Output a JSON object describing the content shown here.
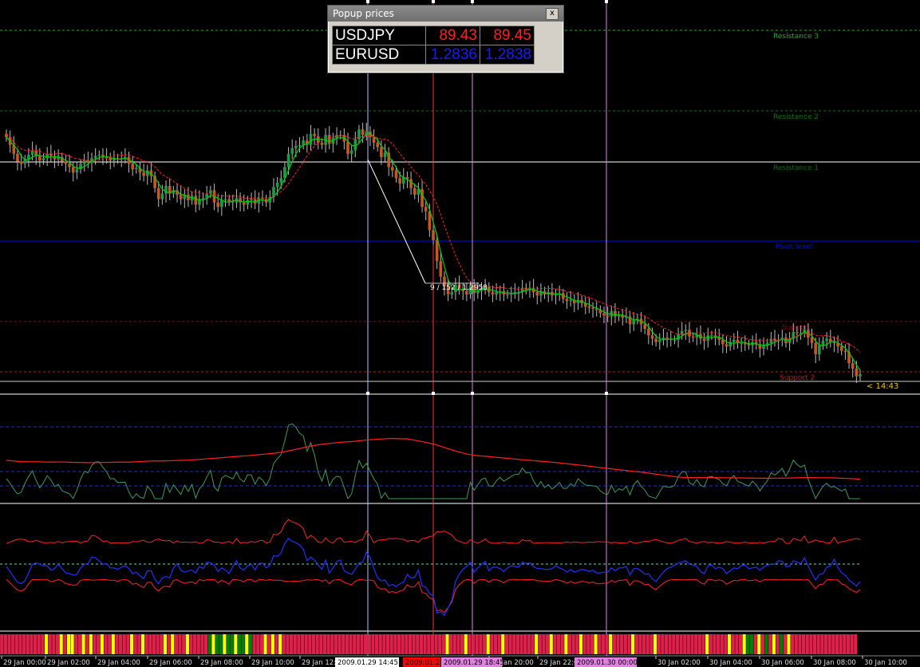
{
  "popup": {
    "title": "Popup prices",
    "close": "x",
    "rows": [
      {
        "symbol": "USDJPY",
        "bid": "89.43",
        "ask": "89.45",
        "color": "#ff2020"
      },
      {
        "symbol": "EURUSD",
        "bid": "1.2836",
        "ask": "1.2838",
        "color": "#1a1aff"
      }
    ]
  },
  "levels": {
    "resistance3": "Resistance 3",
    "resistance2": "Resistance 2",
    "resistance1": "Resistance 1",
    "pivot": "Pivot level",
    "support1": "Support",
    "support2": "Support 2"
  },
  "annotations": {
    "trendline": "9 / 152 / 1.2958",
    "countdown": "< 14:43"
  },
  "time_axis": {
    "labels": [
      "29 Jan 00:00",
      "29 Jan 02:00",
      "29 Jan 04:00",
      "29 Jan 06:00",
      "29 Jan 08:00",
      "29 Jan 10:00",
      "29 Jan 12:00",
      "29 Jan 20:00",
      "29 Jan 22:00",
      "30 Jan 02:00",
      "30 Jan 04:00",
      "30 Jan 06:00",
      "30 Jan 08:00",
      "30 Jan 10:00"
    ],
    "highlights": [
      {
        "text": "2009.01.29 14:45",
        "bg": "#ffffff",
        "fg": "#000000"
      },
      {
        "text": "2009.01.2",
        "bg": "#ff0000",
        "fg": "#000000"
      },
      {
        "text": "2009.01.29 18:45",
        "bg": "#e080e0",
        "fg": "#000000"
      },
      {
        "text": "2009.01.30 00:00",
        "bg": "#e080e0",
        "fg": "#000000"
      }
    ]
  },
  "chart_data": {
    "type": "line",
    "close": [
      1.3022,
      1.3015,
      1.3007,
      1.3,
      1.2998,
      1.3002,
      1.3006,
      1.301,
      1.3005,
      1.3001,
      1.3003,
      1.3007,
      1.3005,
      1.3002,
      1.3004,
      1.3,
      1.2998,
      1.2995,
      1.299,
      1.2993,
      1.2998,
      1.3001,
      1.2999,
      1.3003,
      1.3005,
      1.3006,
      1.3004,
      1.3003,
      1.3001,
      1.3003,
      1.3002,
      1.3003,
      1.3004,
      1.2998,
      1.2993,
      1.2994,
      1.299,
      1.2987,
      1.2992,
      1.2987,
      1.2976,
      1.2966,
      1.2971,
      1.2978,
      1.2971,
      1.2974,
      1.297,
      1.2966,
      1.297,
      1.2965,
      1.2969,
      1.2961,
      1.2966,
      1.2967,
      1.2971,
      1.2974,
      1.2963,
      1.2959,
      1.2965,
      1.2966,
      1.2964,
      1.2963,
      1.2967,
      1.2963,
      1.2961,
      1.2965,
      1.2966,
      1.2962,
      1.2967,
      1.2966,
      1.2963,
      1.2968,
      1.2977,
      1.2981,
      1.2985,
      1.2995,
      1.3007,
      1.3012,
      1.3014,
      1.3015,
      1.3019,
      1.3015,
      1.3025,
      1.3023,
      1.3017,
      1.3015,
      1.3024,
      1.3016,
      1.3021,
      1.3024,
      1.3024,
      1.3018,
      1.3007,
      1.301,
      1.302,
      1.3029,
      1.3024,
      1.3027,
      1.3022,
      1.3017,
      1.3013,
      1.3004,
      1.3008,
      1.2995,
      1.2992,
      1.2985,
      1.298,
      1.2986,
      1.2984,
      1.2976,
      1.297,
      1.2975,
      1.2959,
      1.2955,
      1.2938,
      1.2929,
      1.291,
      1.2896,
      1.2887,
      1.288,
      1.2882,
      1.2889,
      1.2885,
      1.2883,
      1.288,
      1.2888,
      1.2881,
      1.2883,
      1.2886,
      1.2887,
      1.2882,
      1.288,
      1.2882,
      1.2883,
      1.288,
      1.288,
      1.2881,
      1.2882,
      1.2882,
      1.2886,
      1.2884,
      1.2886,
      1.2882,
      1.2879,
      1.2883,
      1.288,
      1.2882,
      1.2879,
      1.288,
      1.2881,
      1.2876,
      1.2874,
      1.2875,
      1.2872,
      1.2875,
      1.2872,
      1.2869,
      1.2868,
      1.2867,
      1.2866,
      1.2863,
      1.2861,
      1.286,
      1.2865,
      1.286,
      1.2861,
      1.2859,
      1.286,
      1.2853,
      1.2857,
      1.2858,
      1.2853,
      1.2849,
      1.2843,
      1.284,
      1.2837,
      1.2839,
      1.2841,
      1.284,
      1.2839,
      1.2839,
      1.2844,
      1.2847,
      1.2848,
      1.2842,
      1.2841,
      1.2844,
      1.284,
      1.2838,
      1.2843,
      1.2843,
      1.2841,
      1.2839,
      1.2835,
      1.2833,
      1.2837,
      1.2839,
      1.2836,
      1.2836,
      1.2835,
      1.2834,
      1.2837,
      1.2835,
      1.2831,
      1.2834,
      1.2836,
      1.284,
      1.2838,
      1.2839,
      1.2841,
      1.2836,
      1.284,
      1.2846,
      1.2845,
      1.2845,
      1.2848,
      1.2841,
      1.2836,
      1.2826,
      1.2834,
      1.2838,
      1.284,
      1.2837,
      1.2836,
      1.2833,
      1.2829,
      1.2828,
      1.2818,
      1.2813,
      1.2806,
      1.2808
    ],
    "ma_fast": "green #00d000",
    "ma_slow": "red dashed #ff2020",
    "colors": {
      "bull": "#1f9a48",
      "bear": "#c8581f",
      "pivot": "#0000ff",
      "resistance": "#18b018",
      "support": "#c01818"
    }
  }
}
